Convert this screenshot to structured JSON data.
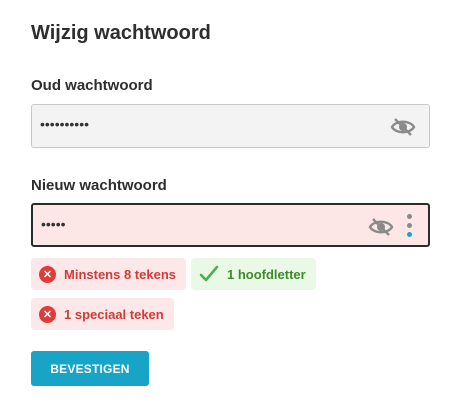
{
  "page": {
    "title": "Wijzig wachtwoord"
  },
  "old_password": {
    "label": "Oud wachtwoord",
    "masked_value": "••••••••••"
  },
  "new_password": {
    "label": "Nieuw wachtwoord",
    "masked_value": "•••••"
  },
  "requirements": [
    {
      "text": "Minstens 8 tekens",
      "status": "unmet"
    },
    {
      "text": "1 hoofdletter",
      "status": "met"
    },
    {
      "text": "1 speciaal teken",
      "status": "unmet"
    }
  ],
  "actions": {
    "confirm_label": "BEVESTIGEN"
  },
  "colors": {
    "accent": "#18a4c7",
    "error": "#e03b3b",
    "success": "#4caf50",
    "error_bg": "#fde6e6"
  },
  "icons": {
    "toggle": "eye-slash-icon",
    "menu": "kebab-menu-icon",
    "unmet": "x-circle-icon",
    "met": "checkmark-icon"
  }
}
